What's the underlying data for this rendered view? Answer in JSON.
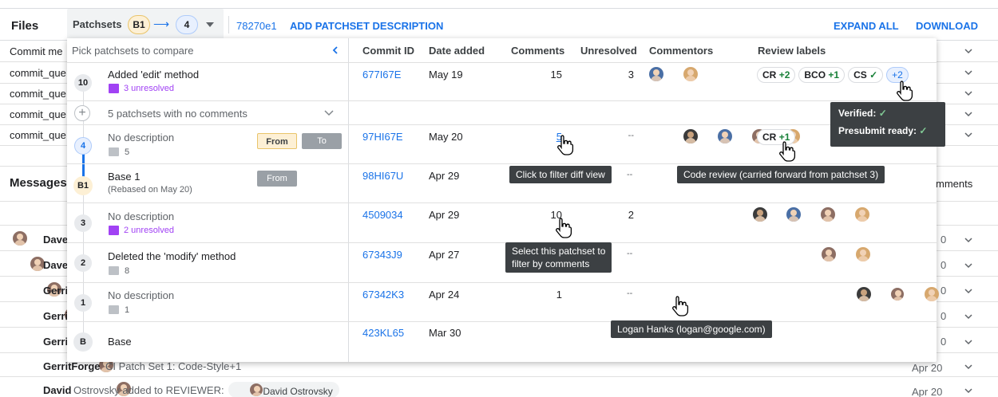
{
  "top_bar": {
    "files_label": "Files",
    "patchsets_label": "Patchsets",
    "from_patchset": "B1",
    "arrow": "⟶",
    "to_patchset": "4",
    "commit_hash": "78270e1",
    "add_description": "ADD PATCHSET DESCRIPTION",
    "expand_all": "EXPAND ALL",
    "download": "DOWNLOAD"
  },
  "background": {
    "file_rows": [
      "Commit me",
      "commit_que",
      "commit_que",
      "commit_que",
      "commit_que"
    ],
    "messages_label": "Messages",
    "comments_label": "mments",
    "message_rows": [
      {
        "author": "Dave",
        "date": "0"
      },
      {
        "author": "Dave",
        "date": "0"
      },
      {
        "author": "Gerri",
        "date": "0"
      },
      {
        "author": "Gerri",
        "date": "0"
      },
      {
        "author": "Gerri",
        "date": "0"
      }
    ],
    "gerritforge_row": {
      "author": "GerritForge",
      "text": " CI Patch Set 1: Code-Style+1",
      "date": "Apr 20"
    },
    "david_row": {
      "author": "David",
      "text": " Ostrovsky added to REVIEWER:",
      "chip": "David Ostrovsky",
      "date": "Apr 20"
    }
  },
  "dropdown": {
    "header_placeholder": "Pick patchsets to compare",
    "columns": {
      "commit_id": "Commit ID",
      "date_added": "Date added",
      "comments": "Comments",
      "unresolved": "Unresolved",
      "commentors": "Commentors",
      "review_labels": "Review labels"
    },
    "collapsed_text": "5 patchsets with no comments",
    "rows": [
      {
        "num": "10",
        "title": "Added 'edit' method",
        "sub": "3 unresolved",
        "commit": "677I67E",
        "date": "May 19",
        "comments": "15",
        "unresolved": "3"
      },
      {
        "num": "4",
        "title": "No description",
        "sub": "5",
        "commit": "97HI67E",
        "date": "May 20",
        "comments": "5",
        "unresolved": "--",
        "from": "From",
        "to": "To"
      },
      {
        "num": "B1",
        "title": "Base 1",
        "sub": "(Rebased on May 20)",
        "commit": "98HI67U",
        "date": "Apr 29",
        "comments": "",
        "unresolved": "--",
        "from": "From"
      },
      {
        "num": "3",
        "title": "No description",
        "sub": "2 unresolved",
        "commit": "4509034",
        "date": "Apr 29",
        "comments": "10",
        "unresolved": "2"
      },
      {
        "num": "2",
        "title": "Deleted the 'modify' method",
        "sub": "8",
        "commit": "67343J9",
        "date": "Apr 27",
        "comments": "",
        "unresolved": "--"
      },
      {
        "num": "1",
        "title": "No description",
        "sub": "1",
        "commit": "67342K3",
        "date": "Apr 24",
        "comments": "1",
        "unresolved": "--"
      },
      {
        "num": "B",
        "title": "Base",
        "sub": "",
        "commit": "423KL65",
        "date": "Mar 30",
        "comments": "",
        "unresolved": ""
      }
    ],
    "labels_row1": [
      {
        "name": "CR",
        "value": "+2"
      },
      {
        "name": "BCO",
        "value": "+1"
      },
      {
        "name": "CS",
        "value": "✓"
      },
      {
        "name": "",
        "value": "+2"
      }
    ],
    "labels_row2": [
      {
        "name": "CR",
        "value": "+1"
      }
    ]
  },
  "tooltips": {
    "verified": "Verified:",
    "presubmit": "Presubmit ready:",
    "check": "✓",
    "filter_diff": "Click to filter diff view",
    "code_review": "Code review (carried forward from patchset 3)",
    "select_patchset_1": "Select this patchset to",
    "select_patchset_2": "filter by comments",
    "logan": "Logan Hanks (logan@google.com)"
  },
  "colors": {
    "accent": "#1a73e8",
    "unresolved_purple": "#a142f4",
    "tooltip_bg": "#3c4043",
    "from_pill": "#fdf0d5",
    "green": "#188038"
  }
}
